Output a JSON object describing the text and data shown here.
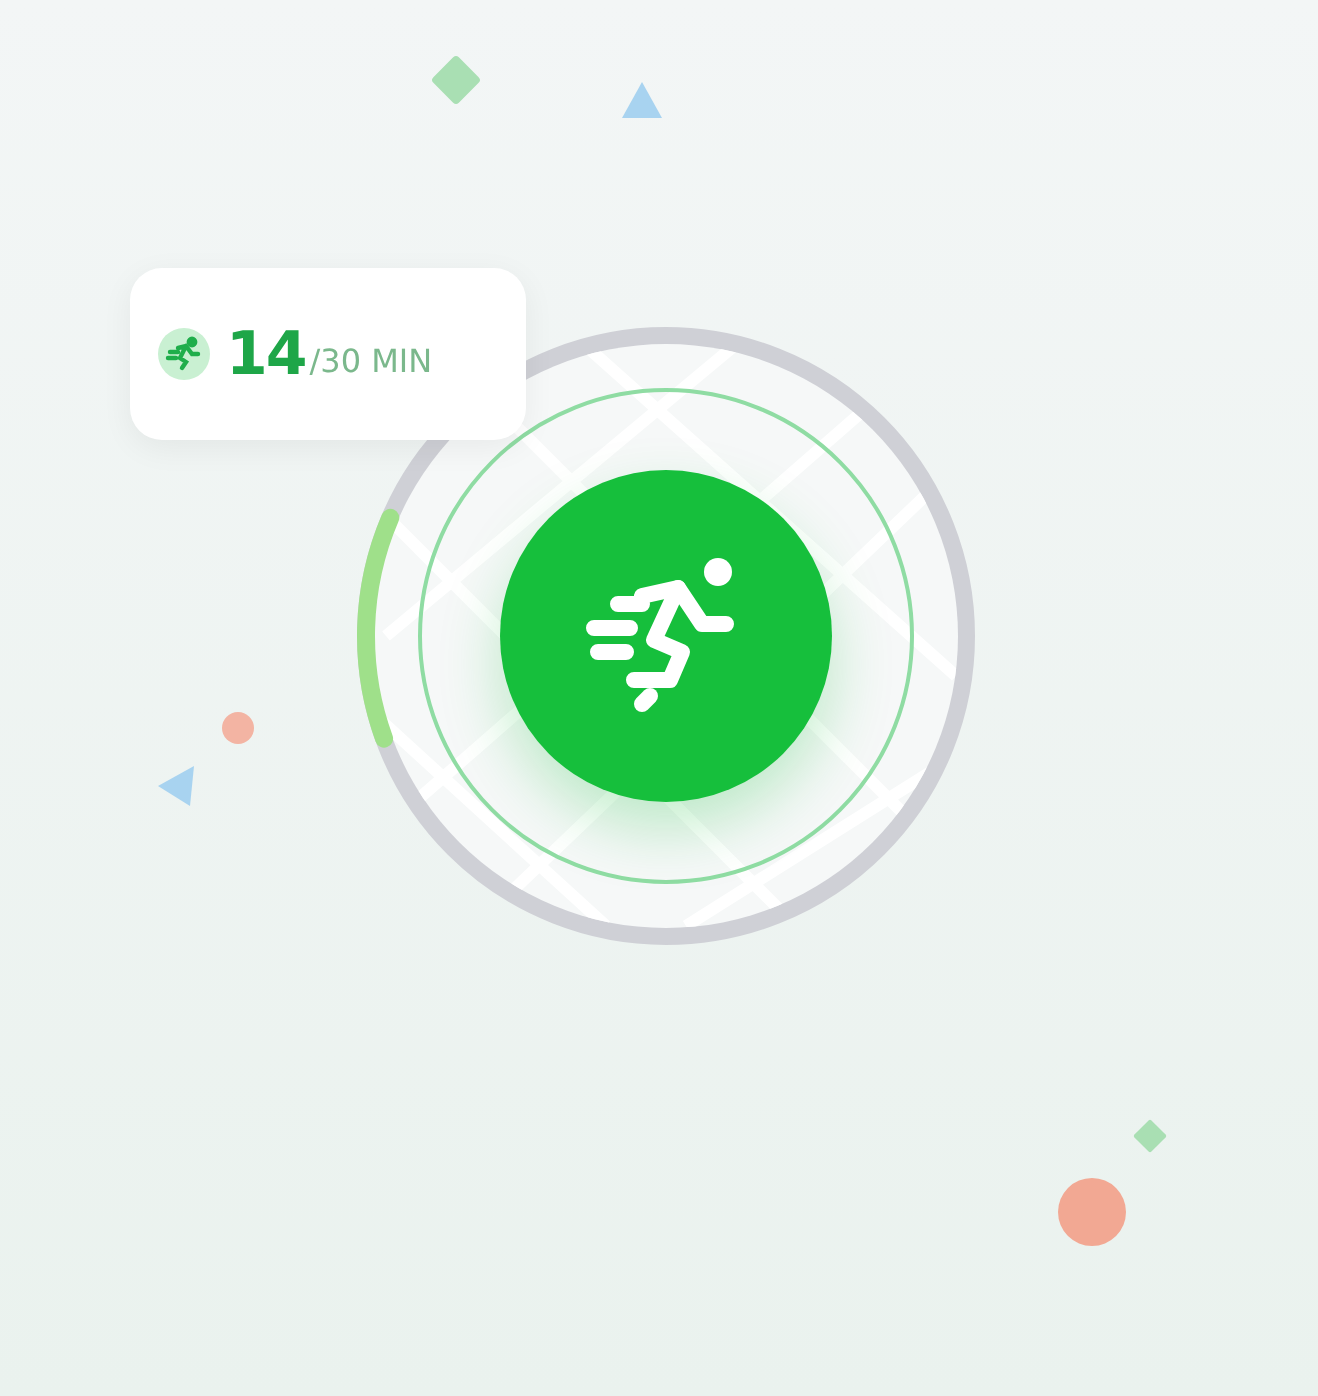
{
  "goal_badge": {
    "value": "14",
    "target": "/30 MIN"
  },
  "ring": {
    "level": 0.12
  }
}
